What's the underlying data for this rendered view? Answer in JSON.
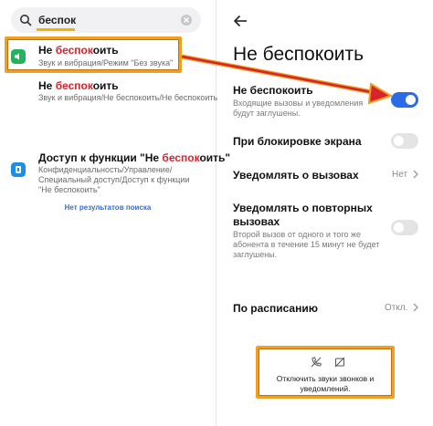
{
  "search": {
    "query": "беспок"
  },
  "results": [
    {
      "title_pre": "Не ",
      "title_hl": "беспок",
      "title_post": "оить",
      "subtitle": "Звук и вибрация/Режим \"Без звука\""
    },
    {
      "title_pre": "Не ",
      "title_hl": "беспок",
      "title_post": "оить",
      "subtitle": "Звук и вибрация/Не беспокоить/Не беспокоить"
    },
    {
      "title_pre": "Доступ к функции \"Не ",
      "title_hl": "беспок",
      "title_post": "оить\"",
      "subtitle_lines": [
        "Конфиденциальность/Управление/",
        "Специальный доступ/Доступ к функции",
        "\"Не беспокоить\""
      ]
    }
  ],
  "no_results": "Нет результатов поиска",
  "settings": {
    "page_title": "Не беспокоить",
    "dnd": {
      "title": "Не беспокоить",
      "subtitle": "Входящие вызовы и уведомления будут заглушены.",
      "enabled": true
    },
    "lock_screen": {
      "title": "При блокировке экрана",
      "enabled": false
    },
    "notify_calls": {
      "title": "Уведомлять о вызовах",
      "value": "Нет"
    },
    "repeat_calls": {
      "title_lines": [
        "Уведомлять о повторных",
        "вызовах"
      ],
      "subtitle": "Второй вызов от одного и того же абонента в течение 15 минут не будет заглушены.",
      "enabled": false
    },
    "schedule": {
      "title": "По расписанию",
      "value": "Откл."
    },
    "callout_text": "Отключить звуки звонков и уведомлений."
  },
  "colors": {
    "accent": "#2b6be6",
    "highlight": "#d7232c",
    "annotation": "#f0a020"
  }
}
